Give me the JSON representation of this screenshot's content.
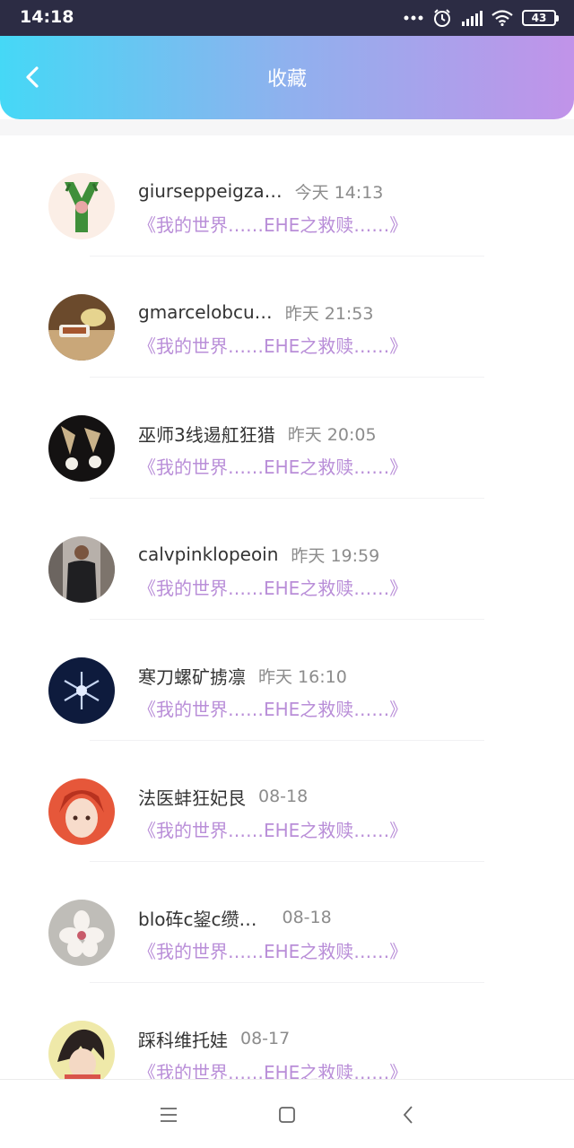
{
  "status_bar": {
    "time": "14:18",
    "battery": "43",
    "icons": [
      "more-dots-icon",
      "alarm-icon",
      "signal-icon",
      "wifi-icon",
      "battery-icon"
    ]
  },
  "header": {
    "title": "收藏",
    "back_icon": "chevron-left-icon"
  },
  "colors": {
    "header_gradient": [
      "#45d8f6",
      "#8fb1ee",
      "#c193e9"
    ],
    "title_link": "#b98ed8",
    "name_text": "#333333",
    "time_text": "#8c8c8c"
  },
  "items": [
    {
      "name": "giurseppeigza…",
      "time": "今天 14:13",
      "title": "《我的世界……EHE之救赎……》"
    },
    {
      "name": "gmarcelobcu…",
      "time": "昨天 21:53",
      "title": "《我的世界……EHE之救赎……》"
    },
    {
      "name": "巫师3线逷舡狂猎",
      "time": "昨天 20:05",
      "title": "《我的世界……EHE之救赎……》"
    },
    {
      "name": "calvpinklopeoin",
      "time": "昨天 19:59",
      "title": "《我的世界……EHE之救赎……》"
    },
    {
      "name": "寒刀螺矿掳凛",
      "time": "昨天 16:10",
      "title": "《我的世界……EHE之救赎……》"
    },
    {
      "name": "法医蚌狂妃艮",
      "time": "08-18",
      "title": "《我的世界……EHE之救赎……》"
    },
    {
      "name": "blo砗c鋆c缵…",
      "time": "08-18",
      "title": "《我的世界……EHE之救赎……》"
    },
    {
      "name": "踩科维托娃",
      "time": "08-17",
      "title": "《我的世界……EHE之救赎……》"
    }
  ],
  "nav": {
    "icons": [
      "menu-icon",
      "home-square-icon",
      "back-triangle-icon"
    ]
  }
}
